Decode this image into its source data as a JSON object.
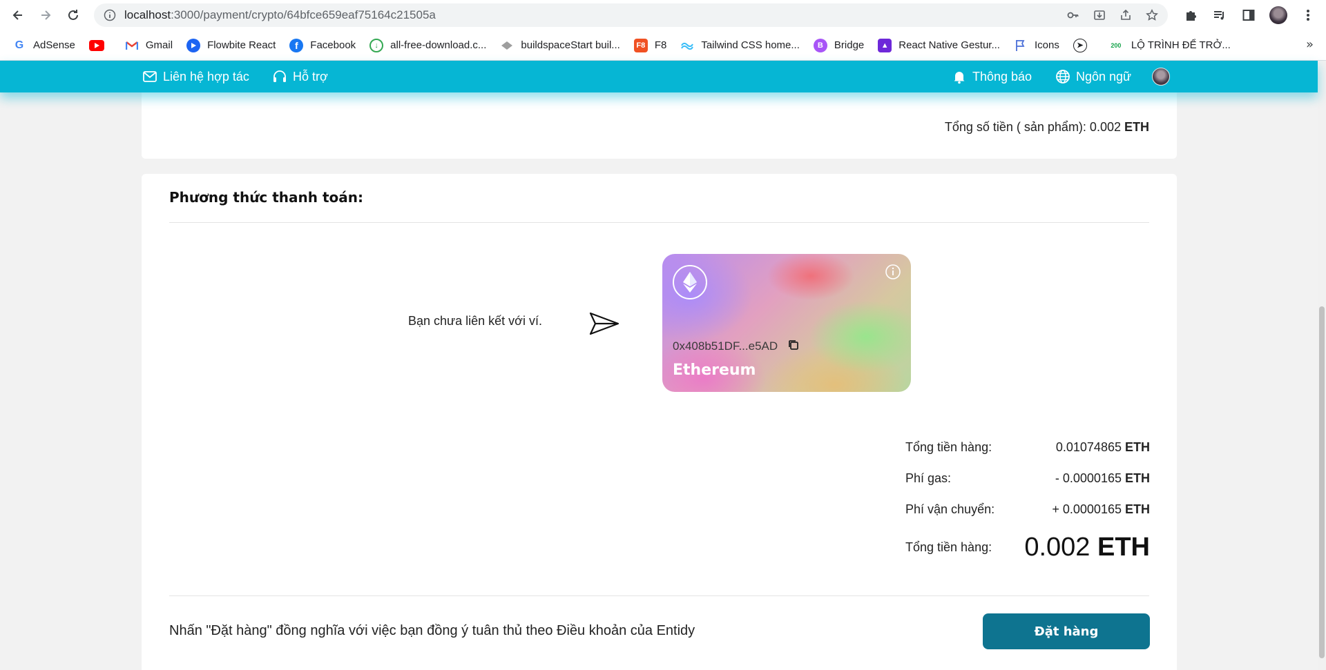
{
  "browser": {
    "url_host": "localhost",
    "url_path": ":3000/payment/crypto/64bfce659eaf75164c21505a",
    "bookmarks": [
      {
        "label": "AdSense",
        "icon": "google-icon"
      },
      {
        "label": "",
        "icon": "youtube-icon"
      },
      {
        "label": "Gmail",
        "icon": "gmail-icon"
      },
      {
        "label": "Flowbite React",
        "icon": "flowbite-icon"
      },
      {
        "label": "Facebook",
        "icon": "facebook-icon"
      },
      {
        "label": "all-free-download.c...",
        "icon": "download-icon"
      },
      {
        "label": "buildspaceStart buil...",
        "icon": "buildspace-icon"
      },
      {
        "label": "F8",
        "icon": "f8-icon"
      },
      {
        "label": "Tailwind CSS home...",
        "icon": "tailwind-icon"
      },
      {
        "label": "Bridge",
        "icon": "bridge-icon"
      },
      {
        "label": "React Native Gestur...",
        "icon": "react-native-icon"
      },
      {
        "label": "Icons",
        "icon": "flag-icon"
      },
      {
        "label": "",
        "icon": "paper-plane-icon"
      },
      {
        "label": "LỘ TRÌNH ĐỂ TRỞ...",
        "icon": "200lab-icon"
      }
    ],
    "more_label": "»"
  },
  "header": {
    "contact_label": "Liên hệ hợp tác",
    "support_label": "Hỗ trợ",
    "notification_label": "Thông báo",
    "language_label": "Ngôn ngữ"
  },
  "summary_top": {
    "label": "Tổng số tiền ( sản phẩm): 0.002",
    "currency": "ETH"
  },
  "payment": {
    "title": "Phương thức thanh toán:",
    "wallet_message": "Bạn chưa liên kết với ví.",
    "card": {
      "address": "0x408b51DF...e5AD",
      "network": "Ethereum"
    }
  },
  "totals": {
    "subtotal_label": "Tổng tiền hàng:",
    "subtotal_value": "0.01074865",
    "gas_label": "Phí gas:",
    "gas_value": "- 0.0000165",
    "shipping_label": "Phí vận chuyển:",
    "shipping_value": "+ 0.0000165",
    "total_label": "Tổng tiền hàng:",
    "total_value": "0.002",
    "currency": "ETH"
  },
  "footer": {
    "terms": "Nhấn \"Đặt hàng\" đồng nghĩa với việc bạn đồng ý tuân thủ theo Điều khoản của Entidy",
    "order_button": "Đặt hàng"
  },
  "colors": {
    "header": "#06b6d4",
    "order_button": "#0e7490"
  }
}
